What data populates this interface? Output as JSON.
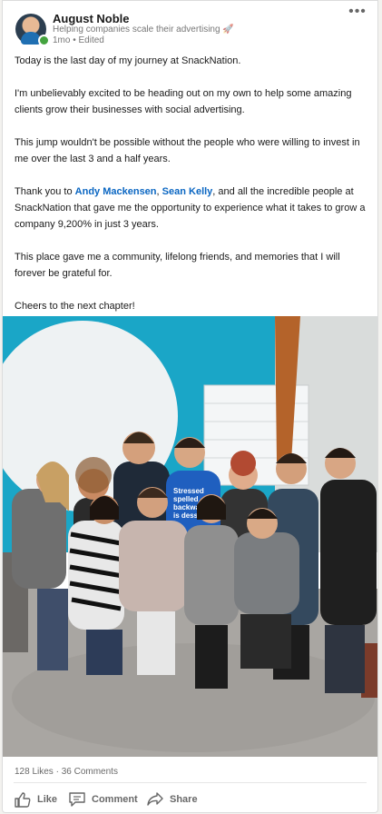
{
  "post": {
    "author": {
      "name": "August Noble",
      "headline": "Helping companies scale their advertising 🚀",
      "meta": "1mo • Edited"
    },
    "body": {
      "p1": "Today is the last day of my journey at SnackNation.",
      "p2": "I'm unbelievably excited to be heading out on my own to help some amazing clients grow their businesses with social advertising.",
      "p3": "This jump wouldn't be possible without the people who were willing to invest in me over the last 3 and a half years.",
      "p4_prefix": "Thank you to ",
      "mention1": "Andy Mackensen",
      "p4_comma": ", ",
      "mention2": "Sean Kelly",
      "p4_suffix": ", and all the incredible people at SnackNation that gave me the opportunity to experience what it takes to grow a company 9,200% in just 3 years.",
      "p5": "This place gave me a community, lifelong friends, and memories that I will forever be grateful for.",
      "p6": "Cheers to the next chapter!"
    },
    "photo_shirt_text": [
      "Stressed",
      "spelled",
      "backwa",
      "is desse"
    ],
    "stats": {
      "likes": "128 Likes",
      "separator": " · ",
      "comments": "36 Comments"
    },
    "actions": {
      "like": "Like",
      "comment": "Comment",
      "share": "Share"
    }
  },
  "icons": {
    "more": "more-options-icon",
    "like": "thumbs-up-icon",
    "comment": "comment-icon",
    "share": "share-arrow-icon"
  },
  "colors": {
    "mention": "#0a66c2",
    "presence": "#44a33f",
    "wall": "#1aa6c7"
  }
}
